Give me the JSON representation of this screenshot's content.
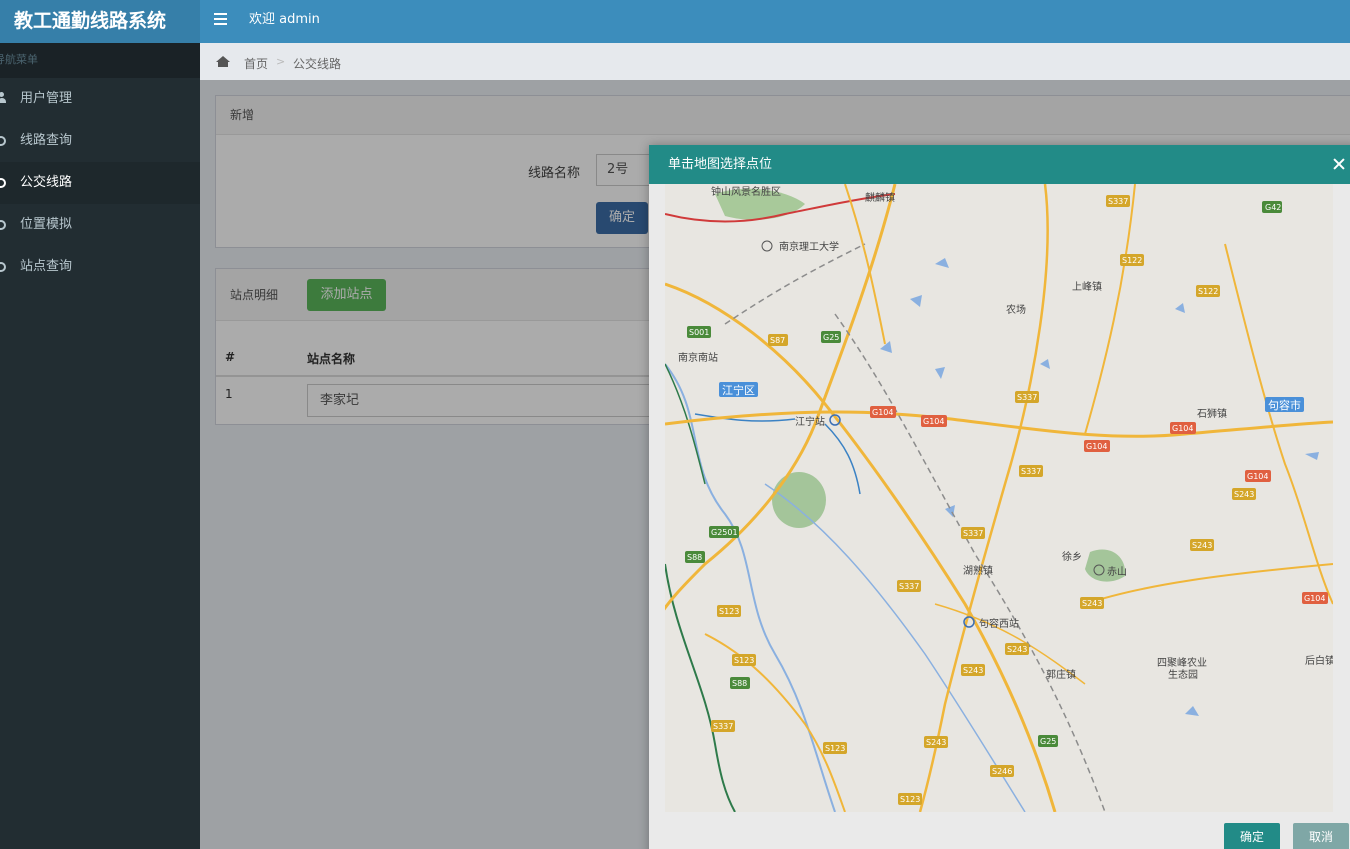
{
  "app": {
    "title": "教工通勤线路系统",
    "welcome": "欢迎 admin"
  },
  "sidebar": {
    "header": "导航菜单",
    "items": [
      {
        "label": "用户管理",
        "icon": "user-icon",
        "active": false
      },
      {
        "label": "线路查询",
        "icon": "circle-icon",
        "active": false
      },
      {
        "label": "公交线路",
        "icon": "circle-icon",
        "active": true
      },
      {
        "label": "位置模拟",
        "icon": "circle-icon",
        "active": false
      },
      {
        "label": "站点查询",
        "icon": "circle-icon",
        "active": false
      }
    ]
  },
  "breadcrumb": {
    "home": "首页",
    "separator": ">",
    "current": "公交线路"
  },
  "form": {
    "panel_title": "新增",
    "route_name_label": "线路名称",
    "route_name_value": "2号",
    "confirm_label": "确定"
  },
  "stations": {
    "panel_title": "站点明细",
    "add_button": "添加站点",
    "columns": [
      "#",
      "站点名称"
    ],
    "rows": [
      {
        "num": "1",
        "name": "李家圮"
      }
    ]
  },
  "modal": {
    "title": "单击地图选择点位",
    "ok_label": "确定",
    "cancel_label": "取消"
  },
  "map": {
    "places": [
      "钟山风景名胜区",
      "麒麟镇",
      "南京理工大学",
      "南京南站",
      "江宁区",
      "江宁站",
      "农场",
      "上峰镇",
      "石狮镇",
      "句容市",
      "湖熟镇",
      "句容西站",
      "徐乡",
      "赤山",
      "郭庄镇",
      "四聚峰农业生态园",
      "后白镇"
    ],
    "road_shields": [
      "S337",
      "G42",
      "S122",
      "S001",
      "S87",
      "G25",
      "G104",
      "S243",
      "G2501",
      "S88",
      "S123",
      "S246"
    ]
  },
  "colors": {
    "header": "#3c8dbc",
    "logo": "#367fa9",
    "sidebar": "#222d32",
    "modal_header": "#228b87",
    "add_button": "#5cb85c",
    "confirm_button": "#3c6ea8"
  }
}
